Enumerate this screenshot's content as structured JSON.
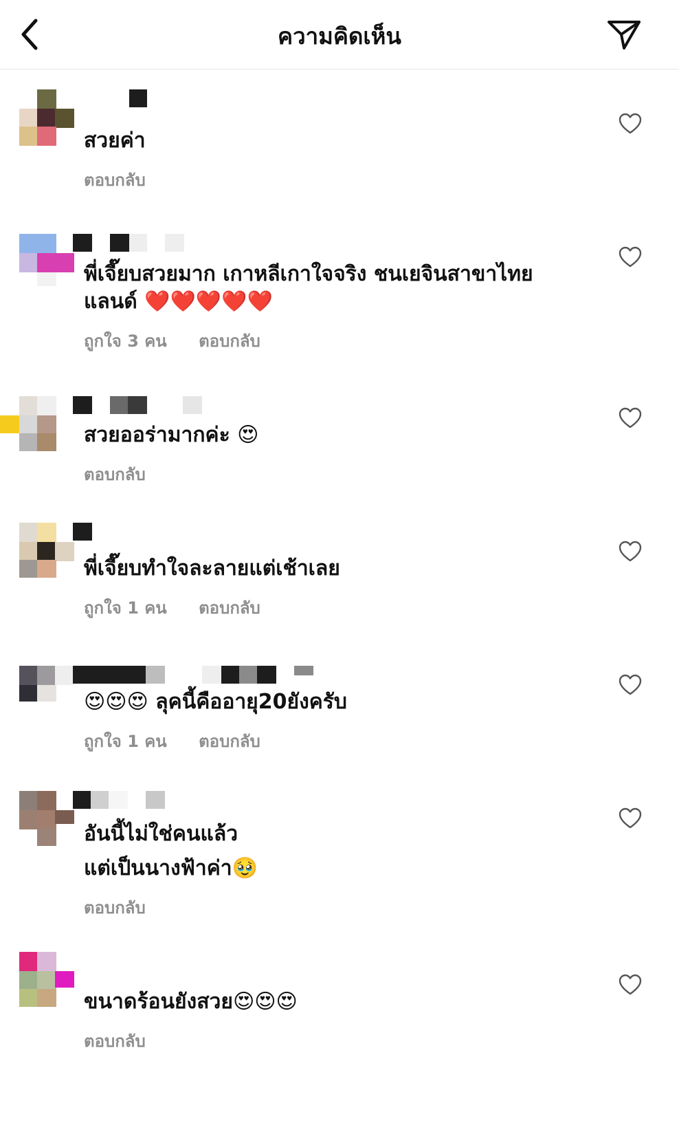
{
  "header": {
    "title": "ความคิดเห็น"
  },
  "labels": {
    "reply": "ตอบกลับ"
  },
  "comments": [
    {
      "text": "สวยค่า",
      "likes": "",
      "reply": "ตอบกลับ"
    },
    {
      "text_line1": "พี่เจี๊ยบสวยมาก เกาหลีเกาใจจริง ชนเยจินสาขาไทย",
      "text_line2": "แลนด์ ❤️❤️❤️❤️❤️",
      "likes": "ถูกใจ 3 คน",
      "reply": "ตอบกลับ"
    },
    {
      "text": "สวยออร่ามากค่ะ 😍",
      "likes": "",
      "reply": "ตอบกลับ"
    },
    {
      "text": "พี่เจี๊ยบทำใจละลายแต่เช้าเลย",
      "likes": "ถูกใจ 1 คน",
      "reply": "ตอบกลับ"
    },
    {
      "text": "😍😍😍 ลุคนี้คืออายุ20ยังครับ",
      "likes": "ถูกใจ 1 คน",
      "reply": "ตอบกลับ"
    },
    {
      "text_line1": "อันนี้ไม่ใช่คนแล้ว",
      "text_line2": "แต่เป็นนางฟ้าค่า🥹",
      "likes": "",
      "reply": "ตอบกลับ"
    },
    {
      "text": "ขนาดร้อนยังสวย😍😍😍",
      "likes": "",
      "reply": "ตอบกลับ"
    }
  ],
  "colors": {
    "meta_gray": "#8e8e8e",
    "divider": "#e4e4e4"
  },
  "icons": {
    "back": "chevron-left-icon",
    "send": "paper-plane-icon",
    "like": "heart-outline-icon"
  }
}
